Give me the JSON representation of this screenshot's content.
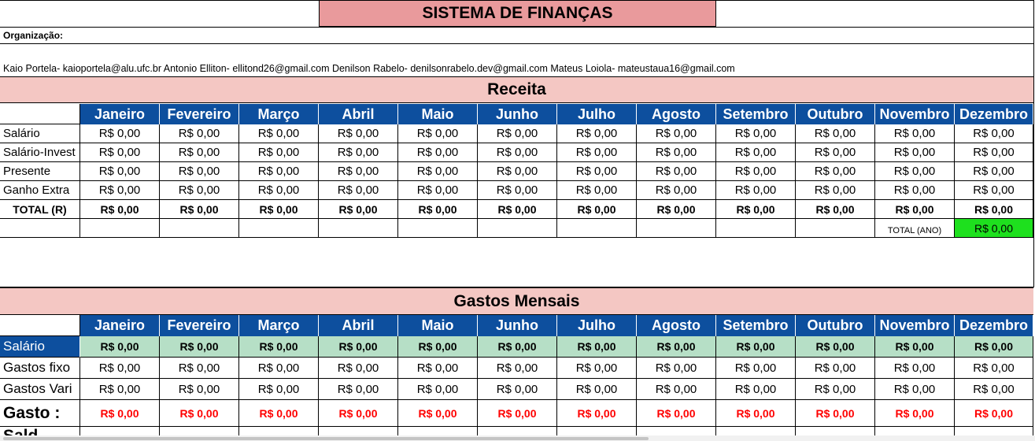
{
  "sheet": {
    "title": "SISTEMA DE FINANÇAS",
    "organization_label": "Organização:",
    "members_line": "Kaio Portela- kaioportela@alu.ufc.br   Antonio Elliton- ellitond26@gmail.com   Denilson Rabelo- denilsonrabelo.dev@gmail.com  Mateus Loiola- mateustaua16@gmail.com"
  },
  "months": [
    "Janeiro",
    "Fevereiro",
    "Março",
    "Abril",
    "Maio",
    "Junho",
    "Julho",
    "Agosto",
    "Setembro",
    "Outubro",
    "Novembro",
    "Dezembro"
  ],
  "receita": {
    "title": "Receita",
    "rows": [
      {
        "label": "Salário",
        "values": [
          "R$ 0,00",
          "R$ 0,00",
          "R$ 0,00",
          "R$ 0,00",
          "R$ 0,00",
          "R$ 0,00",
          "R$ 0,00",
          "R$ 0,00",
          "R$ 0,00",
          "R$ 0,00",
          "R$ 0,00",
          "R$ 0,00"
        ]
      },
      {
        "label": "Salário-Invest",
        "values": [
          "R$ 0,00",
          "R$ 0,00",
          "R$ 0,00",
          "R$ 0,00",
          "R$ 0,00",
          "R$ 0,00",
          "R$ 0,00",
          "R$ 0,00",
          "R$ 0,00",
          "R$ 0,00",
          "R$ 0,00",
          "R$ 0,00"
        ]
      },
      {
        "label": "Presente",
        "values": [
          "R$ 0,00",
          "R$ 0,00",
          "R$ 0,00",
          "R$ 0,00",
          "R$ 0,00",
          "R$ 0,00",
          "R$ 0,00",
          "R$ 0,00",
          "R$ 0,00",
          "R$ 0,00",
          "R$ 0,00",
          "R$ 0,00"
        ]
      },
      {
        "label": "Ganho Extra",
        "values": [
          "R$ 0,00",
          "R$ 0,00",
          "R$ 0,00",
          "R$ 0,00",
          "R$ 0,00",
          "R$ 0,00",
          "R$ 0,00",
          "R$ 0,00",
          "R$ 0,00",
          "R$ 0,00",
          "R$ 0,00",
          "R$ 0,00"
        ]
      }
    ],
    "total_label": "TOTAL (R)",
    "totals": [
      "R$ 0,00",
      "R$ 0,00",
      "R$ 0,00",
      "R$ 0,00",
      "R$ 0,00",
      "R$ 0,00",
      "R$ 0,00",
      "R$ 0,00",
      "R$ 0,00",
      "R$ 0,00",
      "R$ 0,00",
      "R$ 0,00"
    ],
    "year_total_label": "TOTAL (ANO)",
    "year_total_value": "R$ 0,00",
    "year_total_color": "#1ee01e"
  },
  "gastos": {
    "title": "Gastos Mensais",
    "highlight_row": {
      "label": "Salário",
      "values": [
        "R$ 0,00",
        "R$ 0,00",
        "R$ 0,00",
        "R$ 0,00",
        "R$ 0,00",
        "R$ 0,00",
        "R$ 0,00",
        "R$ 0,00",
        "R$ 0,00",
        "R$ 0,00",
        "R$ 0,00",
        "R$ 0,00"
      ]
    },
    "rows": [
      {
        "label": "Gastos fixo",
        "values": [
          "R$ 0,00",
          "R$ 0,00",
          "R$ 0,00",
          "R$ 0,00",
          "R$ 0,00",
          "R$ 0,00",
          "R$ 0,00",
          "R$ 0,00",
          "R$ 0,00",
          "R$ 0,00",
          "R$ 0,00",
          "R$ 0,00"
        ]
      },
      {
        "label": "Gastos Vari",
        "values": [
          "R$ 0,00",
          "R$ 0,00",
          "R$ 0,00",
          "R$ 0,00",
          "R$ 0,00",
          "R$ 0,00",
          "R$ 0,00",
          "R$ 0,00",
          "R$ 0,00",
          "R$ 0,00",
          "R$ 0,00",
          "R$ 0,00"
        ]
      }
    ],
    "gasto_label": "Gasto :",
    "gasto_values": [
      "R$ 0,00",
      "R$ 0,00",
      "R$ 0,00",
      "R$ 0,00",
      "R$ 0,00",
      "R$ 0,00",
      "R$ 0,00",
      "R$ 0,00",
      "R$ 0,00",
      "R$ 0,00",
      "R$ 0,00",
      "R$ 0,00"
    ],
    "partial_next_label": "Sald"
  },
  "colors": {
    "title_bg": "#e99a9c",
    "band_bg": "#f4c7c3",
    "month_header_bg": "#0d4f9e",
    "highlight_row_bg": "#b6dfc6",
    "negative_text": "#ff0000"
  }
}
